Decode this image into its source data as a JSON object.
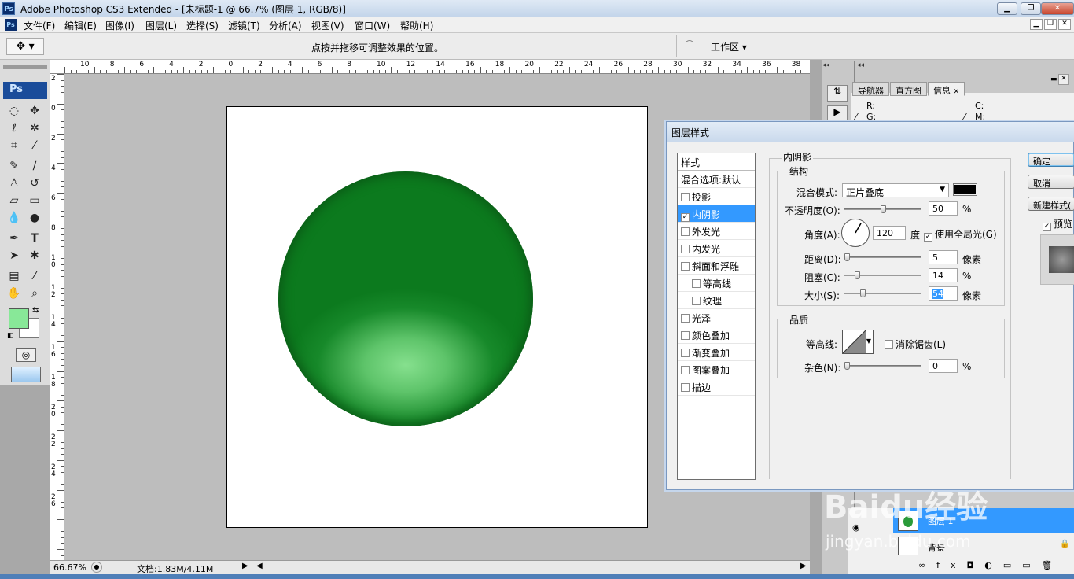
{
  "window": {
    "title": "Adobe Photoshop CS3 Extended - [未标题-1 @ 66.7% (图层 1, RGB/8)]",
    "app_icon": "Ps"
  },
  "menu": [
    "文件(F)",
    "编辑(E)",
    "图像(I)",
    "图层(L)",
    "选择(S)",
    "滤镜(T)",
    "分析(A)",
    "视图(V)",
    "窗口(W)",
    "帮助(H)"
  ],
  "options_bar": {
    "hint": "点按并拖移可调整效果的位置。",
    "workspace_label": "工作区"
  },
  "ruler": {
    "h_labels": [
      "10",
      "8",
      "6",
      "4",
      "2",
      "0",
      "2",
      "4",
      "6",
      "8",
      "10",
      "12",
      "14",
      "16",
      "18",
      "20",
      "22",
      "24",
      "26",
      "28",
      "30",
      "32",
      "34",
      "36",
      "38"
    ],
    "v_labels": [
      "2",
      "0",
      "2",
      "4",
      "6",
      "8",
      "1 0",
      "1 2",
      "1 4",
      "1 6",
      "1 8",
      "2 0",
      "2 2",
      "2 4",
      "2 6"
    ]
  },
  "toolbox": {
    "badge": "Ps",
    "foreground_color": "#88e898",
    "background_color": "#ffffff"
  },
  "status": {
    "zoom": "66.67%",
    "doc_info": "文档:1.83M/4.11M"
  },
  "panels": {
    "tabs": [
      "导航器",
      "直方图",
      "信息"
    ],
    "info": {
      "r_label": "R:",
      "g_label": "G:",
      "c_label": "C:",
      "m_label": "M:"
    },
    "layers": {
      "layer1": "图层 1",
      "background": "背景"
    }
  },
  "dialog": {
    "title": "图层样式",
    "list_header": "样式",
    "styles": [
      {
        "label": "混合选项:默认",
        "checkbox": false,
        "indent": false,
        "selected": false
      },
      {
        "label": "投影",
        "checkbox": true,
        "checked": false,
        "indent": false,
        "selected": false
      },
      {
        "label": "内阴影",
        "checkbox": true,
        "checked": true,
        "indent": false,
        "selected": true
      },
      {
        "label": "外发光",
        "checkbox": true,
        "checked": false,
        "indent": false,
        "selected": false
      },
      {
        "label": "内发光",
        "checkbox": true,
        "checked": false,
        "indent": false,
        "selected": false
      },
      {
        "label": "斜面和浮雕",
        "checkbox": true,
        "checked": false,
        "indent": false,
        "selected": false
      },
      {
        "label": "等高线",
        "checkbox": true,
        "checked": false,
        "indent": true,
        "selected": false
      },
      {
        "label": "纹理",
        "checkbox": true,
        "checked": false,
        "indent": true,
        "selected": false
      },
      {
        "label": "光泽",
        "checkbox": true,
        "checked": false,
        "indent": false,
        "selected": false
      },
      {
        "label": "颜色叠加",
        "checkbox": true,
        "checked": false,
        "indent": false,
        "selected": false
      },
      {
        "label": "渐变叠加",
        "checkbox": true,
        "checked": false,
        "indent": false,
        "selected": false
      },
      {
        "label": "图案叠加",
        "checkbox": true,
        "checked": false,
        "indent": false,
        "selected": false
      },
      {
        "label": "描边",
        "checkbox": true,
        "checked": false,
        "indent": false,
        "selected": false
      }
    ],
    "section_title": "内阴影",
    "structure": {
      "title": "结构",
      "blend_mode_label": "混合模式:",
      "blend_mode_value": "正片叠底",
      "shadow_color": "#000000",
      "opacity_label": "不透明度(O):",
      "opacity_value": "50",
      "angle_label": "角度(A):",
      "angle_value": "120",
      "angle_unit": "度",
      "global_light_label": "使用全局光(G)",
      "global_light_checked": true,
      "distance_label": "距离(D):",
      "distance_value": "5",
      "choke_label": "阻塞(C):",
      "choke_value": "14",
      "size_label": "大小(S):",
      "size_value": "54",
      "unit_px": "像素",
      "unit_pct": "%"
    },
    "quality": {
      "title": "品质",
      "contour_label": "等高线:",
      "antialias_label": "消除锯齿(L)",
      "noise_label": "杂色(N):",
      "noise_value": "0"
    },
    "buttons": {
      "ok": "确定",
      "cancel": "取消",
      "new_style": "新建样式(",
      "preview": "预览"
    }
  },
  "watermark": {
    "text": "Baidu经验",
    "url": "jingyan.baidu.com"
  }
}
